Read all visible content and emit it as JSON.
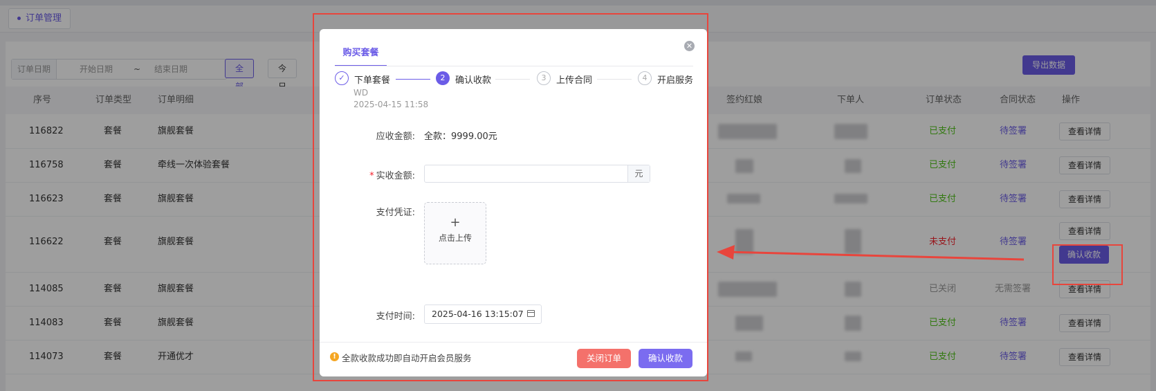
{
  "page": {
    "tab_label": "订单管理"
  },
  "filters": {
    "date_label": "订单日期",
    "start_placeholder": "开始日期",
    "separator": "~",
    "end_placeholder": "结束日期",
    "quick_all": "全部",
    "quick_today": "今日",
    "export_label": "导出数据"
  },
  "table": {
    "headers": {
      "id": "序号",
      "type": "订单类型",
      "detail": "订单明细",
      "sign_red": "签约红娘",
      "orderer": "下单人",
      "status": "订单状态",
      "contract": "合同状态",
      "action": "操作"
    },
    "rows": [
      {
        "id": "116822",
        "type": "套餐",
        "detail": "旗舰套餐",
        "status": "已支付",
        "contract": "待签署",
        "btn": "查看详情"
      },
      {
        "id": "116758",
        "type": "套餐",
        "detail": "牵线一次体验套餐",
        "status": "已支付",
        "contract": "待签署",
        "btn": "查看详情"
      },
      {
        "id": "116623",
        "type": "套餐",
        "detail": "旗舰套餐",
        "status": "已支付",
        "contract": "待签署",
        "btn": "查看详情"
      },
      {
        "id": "116622",
        "type": "套餐",
        "detail": "旗舰套餐",
        "status": "未支付",
        "contract": "待签署",
        "btn": "查看详情",
        "btn2": "确认收款"
      },
      {
        "id": "114085",
        "type": "套餐",
        "detail": "旗舰套餐",
        "status": "已关闭",
        "contract": "无需签署",
        "btn": "查看详情"
      },
      {
        "id": "114083",
        "type": "套餐",
        "detail": "旗舰套餐",
        "status": "已支付",
        "contract": "待签署",
        "btn": "查看详情"
      },
      {
        "id": "114073",
        "type": "套餐",
        "detail": "开通优才",
        "status": "已支付",
        "contract": "待签署",
        "btn": "查看详情"
      }
    ]
  },
  "dialog": {
    "tab": "购买套餐",
    "close_icon": "circle-x",
    "steps": [
      {
        "num": "1",
        "label": "下单套餐",
        "state": "done"
      },
      {
        "num": "2",
        "label": "确认收款",
        "state": "current"
      },
      {
        "num": "3",
        "label": "上传合同",
        "state": "wait"
      },
      {
        "num": "4",
        "label": "开启服务",
        "state": "wait"
      }
    ],
    "step1_sub_name": "WD",
    "step1_sub_time": "2025-04-15 11:58",
    "receivable_label": "应收金额:",
    "receivable_value": "全款：9999.00元",
    "actual_label": "实收金额:",
    "actual_value": "",
    "actual_suffix": "元",
    "voucher_label": "支付凭证:",
    "upload_plus": "+",
    "upload_text": "点击上传",
    "time_label": "支付时间:",
    "time_value": "2025-04-16 13:15:07",
    "footer_notice": "全款收款成功即自动开启会员服务",
    "btn_close_order": "关闭订单",
    "btn_confirm": "确认收款"
  },
  "colors": {
    "accent": "#6b5ce7",
    "annotation": "#e8453c",
    "paid": "#52c41a",
    "unpaid": "#f5222d",
    "danger_button": "#f4716b"
  }
}
